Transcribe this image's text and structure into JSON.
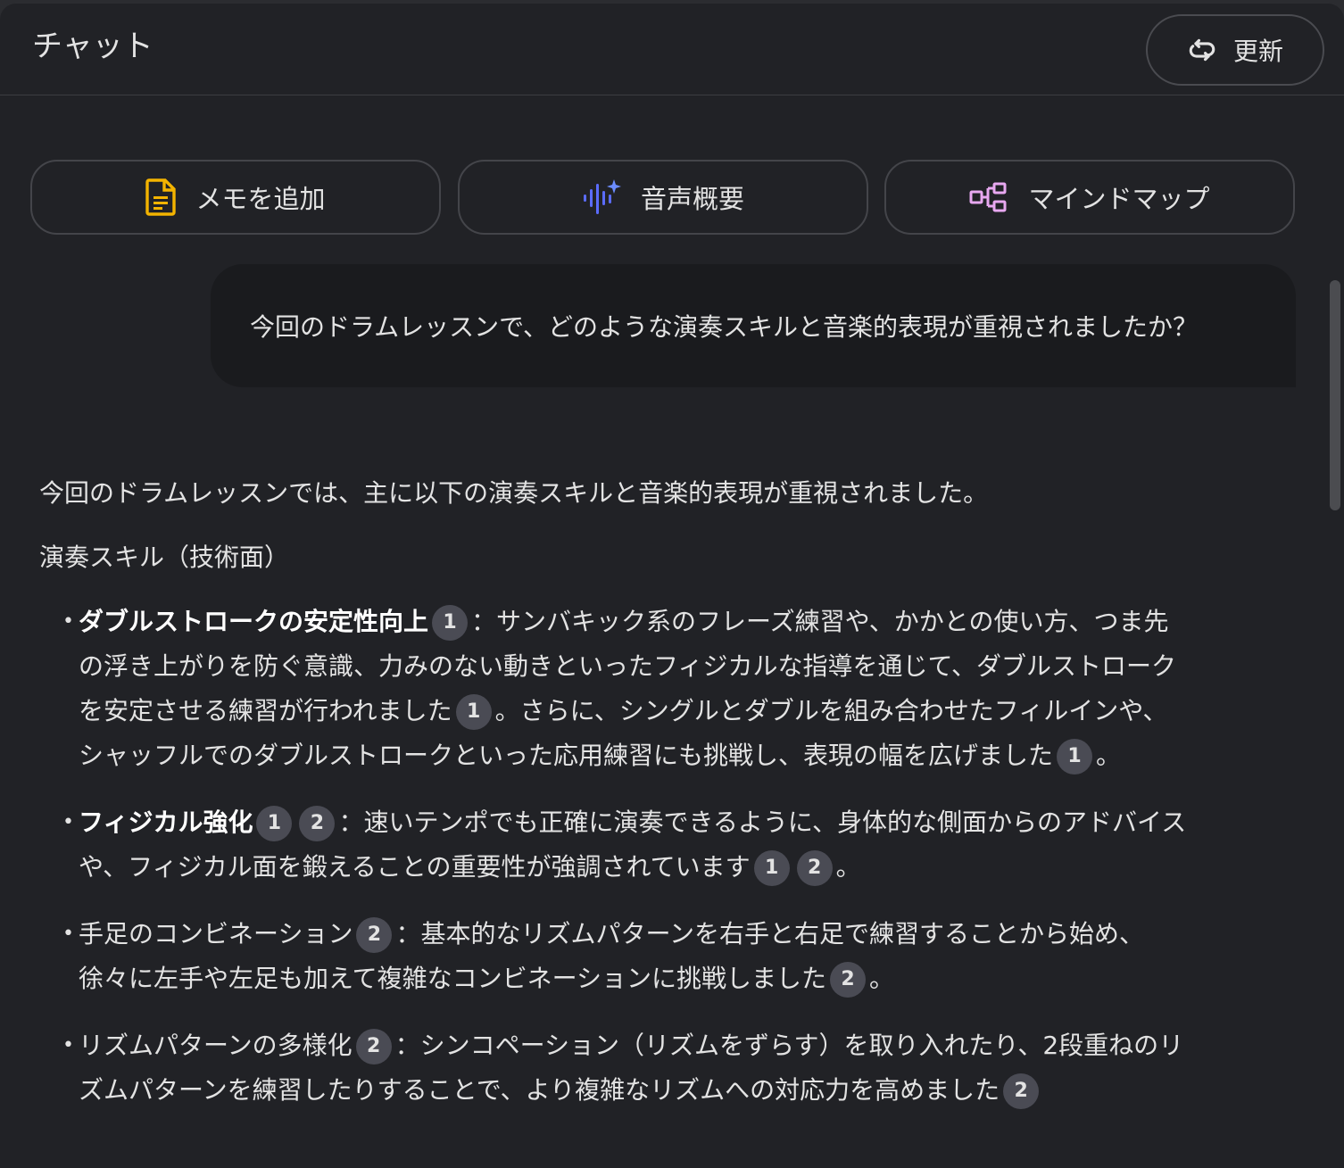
{
  "header": {
    "title": "チャット",
    "refresh_label": "更新"
  },
  "actions": [
    {
      "label": "メモを追加",
      "icon": "note-icon",
      "color": "#f4b400"
    },
    {
      "label": "音声概要",
      "icon": "audio-wave-icon",
      "color": "#5b6cff"
    },
    {
      "label": "マインドマップ",
      "icon": "mindmap-icon",
      "color": "#e8a8f0"
    }
  ],
  "user_message": "今回のドラムレッスンで、どのような演奏スキルと音楽的表現が重視されましたか？",
  "response": {
    "intro": "今回のドラムレッスンでは、主に以下の演奏スキルと音楽的表現が重視されました。",
    "section_heading": "演奏スキル（技術面）",
    "bullets": [
      {
        "title": "ダブルストロークの安定性向上",
        "title_citations": [
          "1"
        ],
        "segments": [
          {
            "text": "：サンバキック系のフレーズ練習や、かかとの使い方、つま先の浮き上がりを防ぐ意識、力みのない動きといったフィジカルな指導を通じて、ダブルストロークを安定させる練習が行われました",
            "cite": [
              "1"
            ]
          },
          {
            "text": "。さらに、シングルとダブルを組み合わせたフィルインや、シャッフルでのダブルストロークといった応用練習にも挑戦し、表現の幅を広げました",
            "cite": [
              "1"
            ]
          },
          {
            "text": "。",
            "cite": []
          }
        ]
      },
      {
        "title": "フィジカル強化",
        "title_citations": [
          "1",
          "2"
        ],
        "segments": [
          {
            "text": "：速いテンポでも正確に演奏できるように、身体的な側面からのアドバイスや、フィジカル面を鍛えることの重要性が強調されています",
            "cite": [
              "1",
              "2"
            ]
          },
          {
            "text": "。",
            "cite": []
          }
        ]
      },
      {
        "title": "手足のコンビネーション",
        "title_bold": false,
        "title_citations": [
          "2"
        ],
        "segments": [
          {
            "text": "：基本的なリズムパターンを右手と右足で練習することから始め、徐々に左手や左足も加えて複雑なコンビネーションに挑戦しました",
            "cite": [
              "2"
            ]
          },
          {
            "text": "。",
            "cite": []
          }
        ]
      },
      {
        "title": "リズムパターンの多様化",
        "title_bold": false,
        "title_citations": [
          "2"
        ],
        "segments": [
          {
            "text": "：シンコペーション（リズムをずらす）を取り入れたり、2段重ねのリズムパターンを練習したりすることで、より複雑なリズムへの対応力を高めました",
            "cite": [
              "2"
            ]
          }
        ]
      }
    ]
  }
}
